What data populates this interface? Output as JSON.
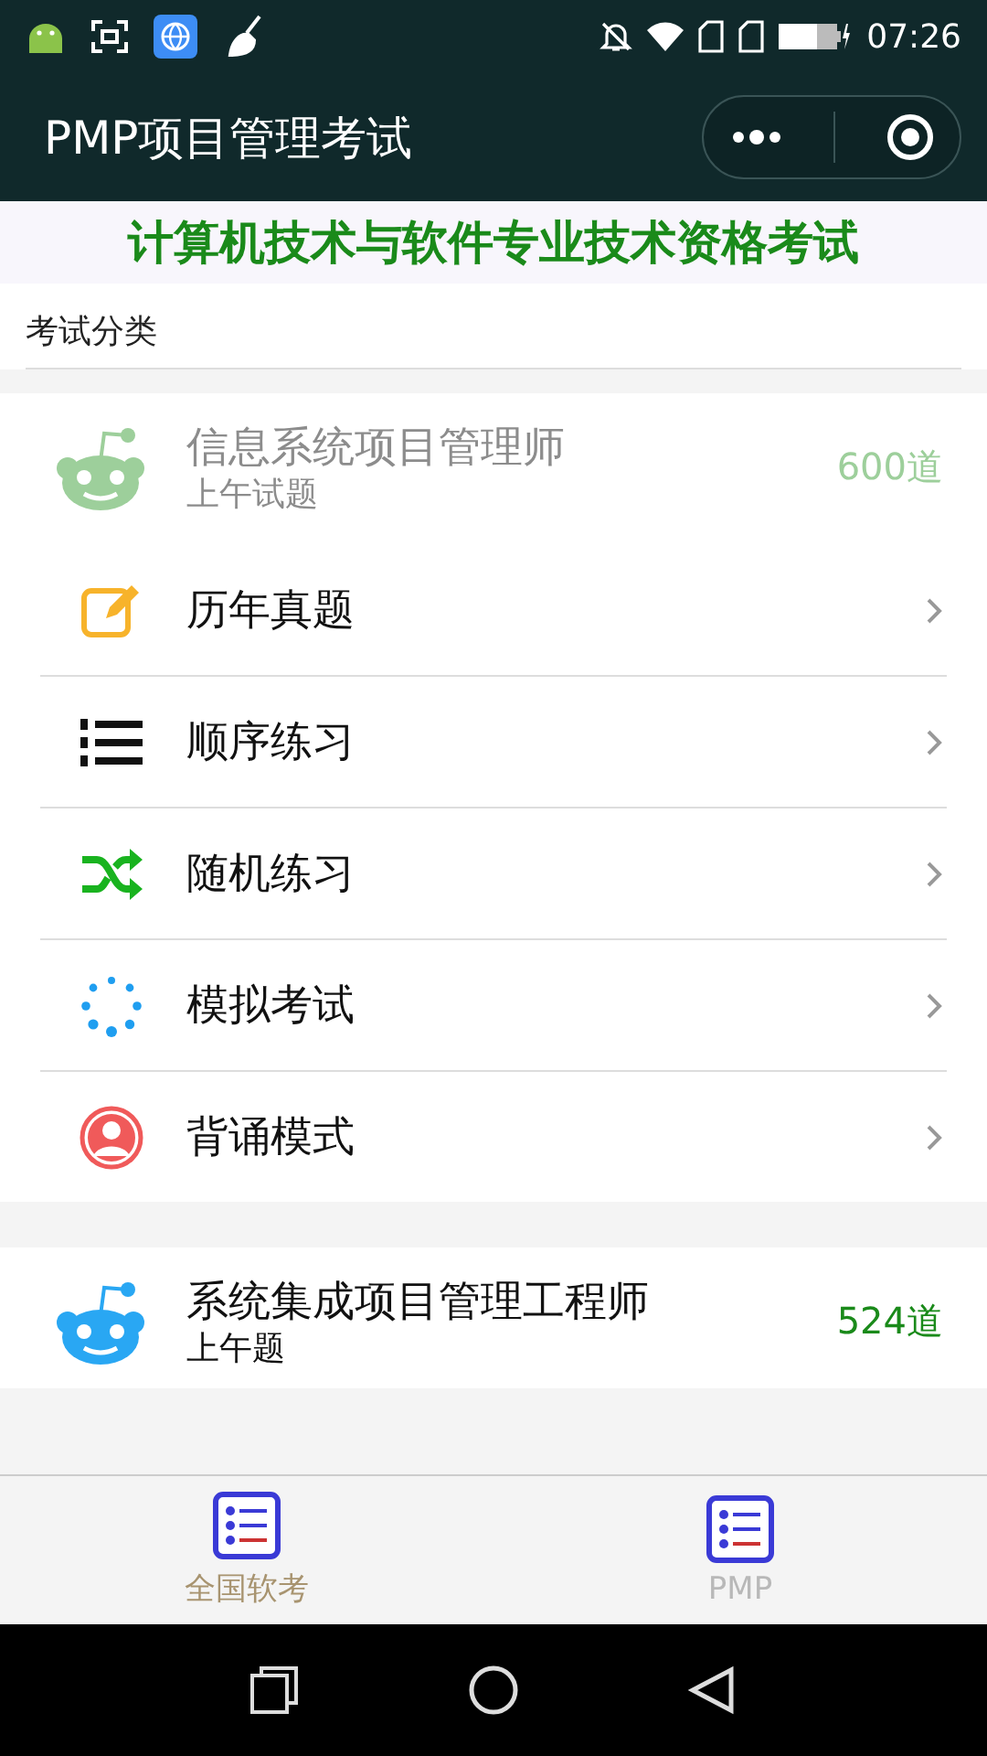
{
  "status_bar": {
    "time": "07:26"
  },
  "title_bar": {
    "title": "PMP项目管理考试"
  },
  "banner": "计算机技术与软件专业技术资格考试",
  "section_title": "考试分类",
  "categories": [
    {
      "name": "信息系统项目管理师",
      "subtitle": "上午试题",
      "count": "600道",
      "dimmed": true,
      "items": [
        {
          "kind": "edit",
          "label": "历年真题"
        },
        {
          "kind": "list",
          "label": "顺序练习"
        },
        {
          "kind": "shuffle",
          "label": "随机练习"
        },
        {
          "kind": "dots",
          "label": "模拟考试"
        },
        {
          "kind": "person",
          "label": "背诵模式"
        }
      ]
    },
    {
      "name": "系统集成项目管理工程师",
      "subtitle": "上午题",
      "count": "524道",
      "dimmed": false
    }
  ],
  "tabs": [
    {
      "label": "全国软考",
      "selected": true
    },
    {
      "label": "PMP",
      "selected": false
    }
  ]
}
